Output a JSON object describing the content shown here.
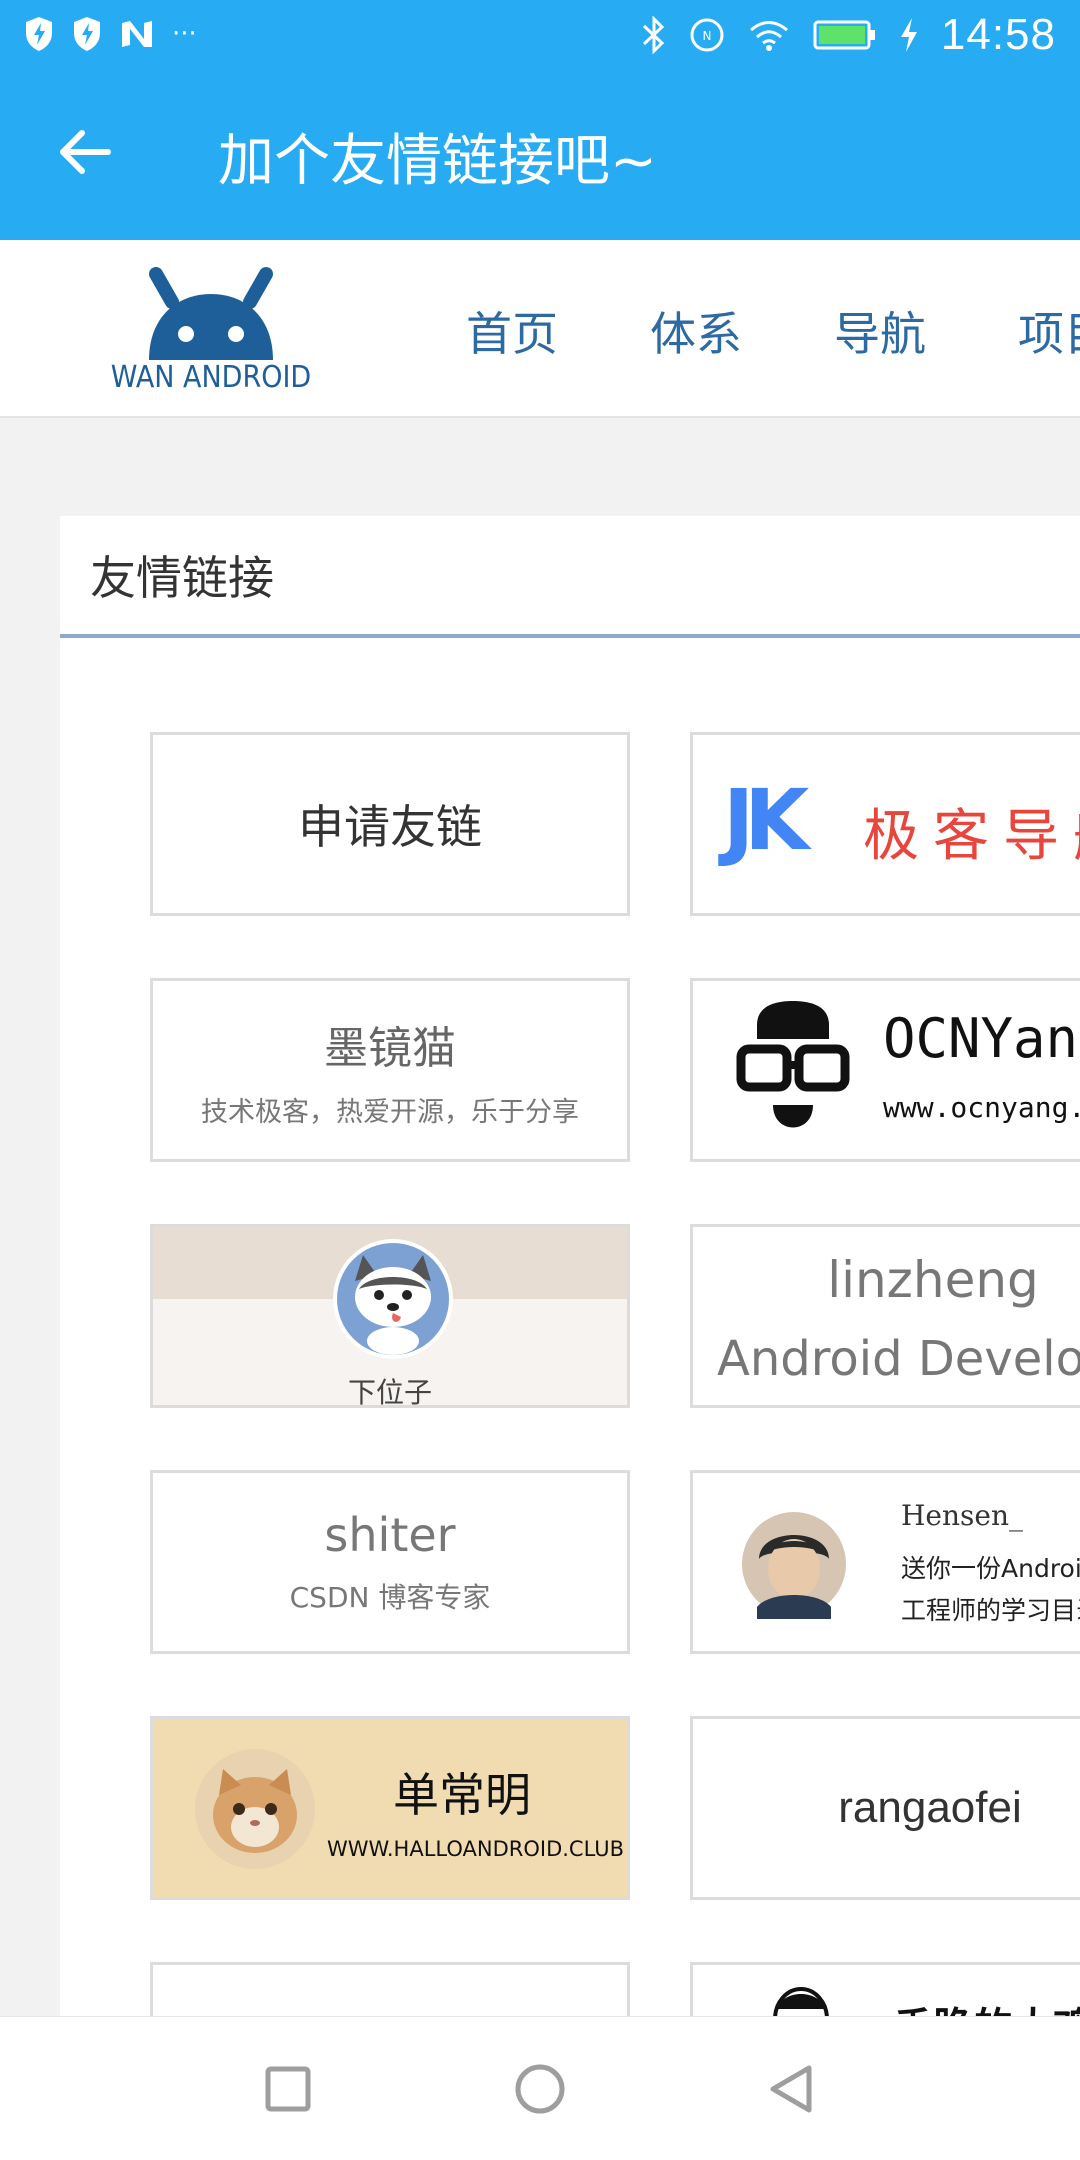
{
  "status_bar": {
    "time": "14:58",
    "left_icons": [
      "shield-bolt-icon",
      "shield-bolt-icon",
      "n-logo-icon",
      "more-dots-icon"
    ],
    "right_icons": [
      "bluetooth-icon",
      "nfc-icon",
      "wifi-icon",
      "battery-icon",
      "charging-icon"
    ],
    "more": "···"
  },
  "app_bar": {
    "title": "加个友情链接吧~",
    "background": "#27acf3"
  },
  "site": {
    "logo_text": "WAN ANDROID",
    "nav": [
      "首页",
      "体系",
      "导航",
      "项目"
    ]
  },
  "panel": {
    "title": "友情链接"
  },
  "links": [
    {
      "name": "申请友链"
    },
    {
      "name": "极客导航",
      "brand_letters": "JK"
    },
    {
      "name": "墨镜猫",
      "subtitle": "技术极客，热爱开源，乐于分享"
    },
    {
      "name": "OCNYang",
      "subtitle": "www.ocnyang.com"
    },
    {
      "name": "下位子"
    },
    {
      "name": "linzheng",
      "subtitle": "Android Developer"
    },
    {
      "name": "shiter",
      "subtitle": "CSDN 博客专家"
    },
    {
      "name": "Hensen_",
      "subtitle": "送你一份Android",
      "subtitle2": "工程师的学习目录"
    },
    {
      "name": "单常明",
      "subtitle": "WWW.HALLOANDROID.CLUB"
    },
    {
      "name": "rangaofei"
    },
    {
      "name": ""
    },
    {
      "name": "香脆的大鸡"
    }
  ],
  "colors": {
    "accent": "#27acf3",
    "nav_text": "#2d6aa3",
    "logo": "#1f5f99"
  }
}
